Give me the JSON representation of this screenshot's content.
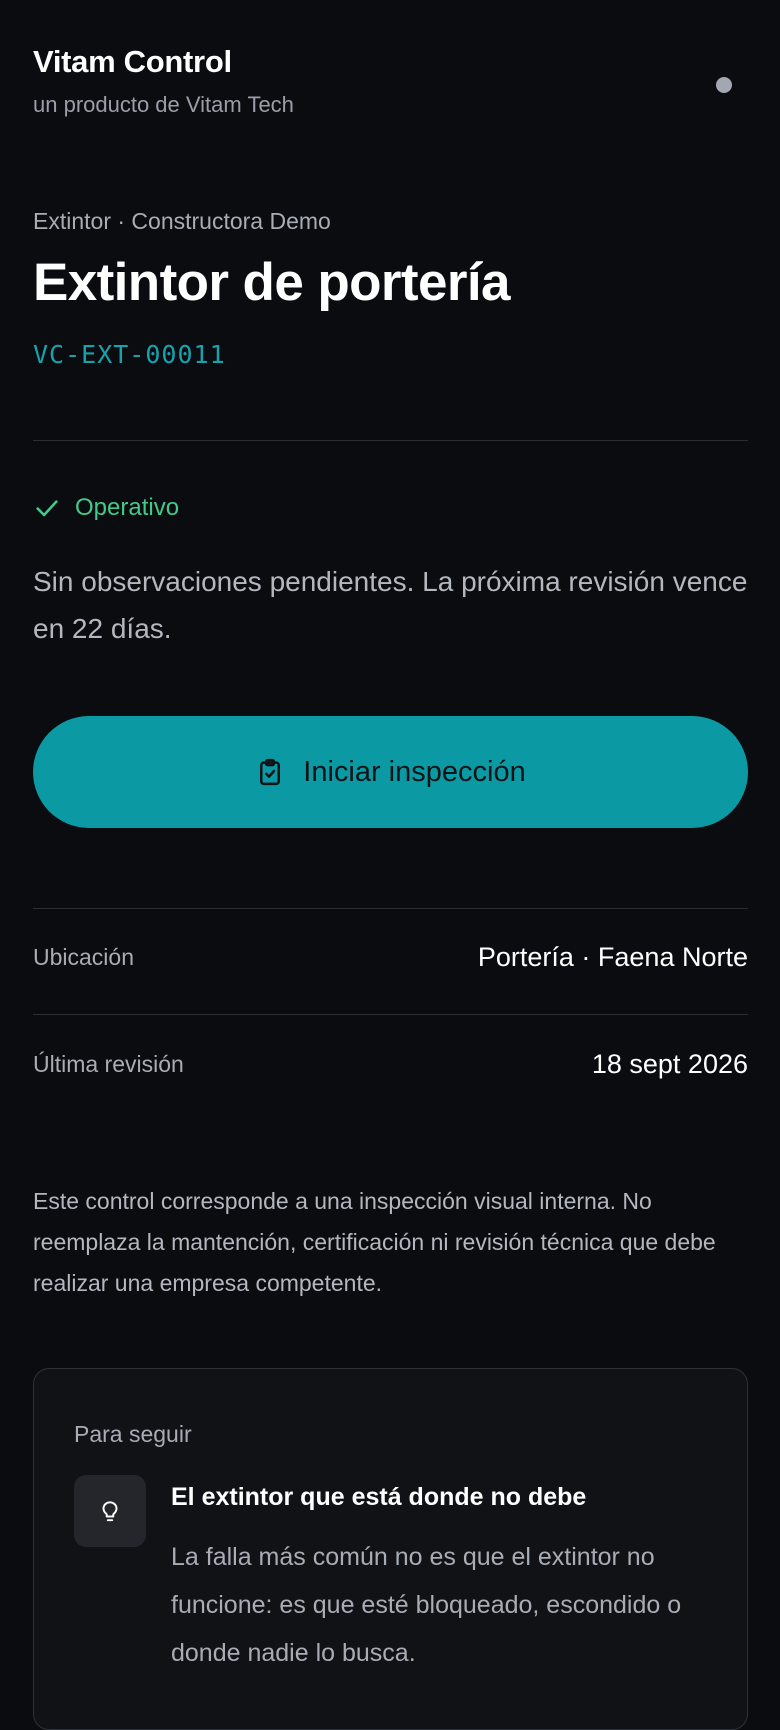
{
  "header": {
    "brand_title": "Vitam Control",
    "brand_subtitle": "un producto de Vitam Tech"
  },
  "asset": {
    "breadcrumb": "Extintor · Constructora Demo",
    "title": "Extintor de portería",
    "code": "VC-EXT-00011"
  },
  "status": {
    "icon": "check-icon",
    "label": "Operativo",
    "color": "#43c98a",
    "description": "Sin observaciones pendientes. La próxima revisión vence en 22 días."
  },
  "actions": {
    "start_inspection_label": "Iniciar inspección",
    "start_inspection_icon": "clipboard-check-icon",
    "button_color": "#0b9aa3"
  },
  "details": [
    {
      "label": "Ubicación",
      "value": "Portería · Faena Norte"
    },
    {
      "label": "Última revisión",
      "value": "18 sept 2026"
    }
  ],
  "disclaimer": "Este control corresponde a una inspección visual interna. No reemplaza la mantención, certificación ni revisión técnica que debe realizar una empresa competente.",
  "tips": {
    "heading": "Para seguir",
    "items": [
      {
        "icon": "lightbulb-icon",
        "title": "El extintor que está donde no debe",
        "body": "La falla más común no es que el extintor no funcione: es que esté bloqueado, escondido o donde nadie lo busca."
      }
    ]
  },
  "colors": {
    "background": "#0b0c0f",
    "accent": "#16a3ad",
    "success": "#43c98a"
  }
}
